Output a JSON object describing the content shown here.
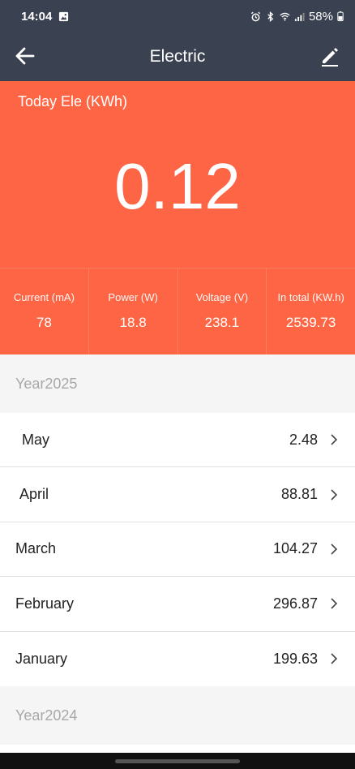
{
  "status_bar": {
    "time": "14:04",
    "battery": "58%"
  },
  "app_bar": {
    "title": "Electric"
  },
  "today": {
    "label": "Today Ele (KWh)",
    "value": "0.12"
  },
  "stats": [
    {
      "label": "Current (mA)",
      "value": "78"
    },
    {
      "label": "Power (W)",
      "value": "18.8"
    },
    {
      "label": "Voltage (V)",
      "value": "238.1"
    },
    {
      "label": "In total (KW.h)",
      "value": "2539.73"
    }
  ],
  "years": [
    {
      "label": "Year2025",
      "months": [
        {
          "name": "May",
          "value": "2.48"
        },
        {
          "name": "April",
          "value": "88.81"
        },
        {
          "name": "March",
          "value": "104.27"
        },
        {
          "name": "February",
          "value": "296.87"
        },
        {
          "name": "January",
          "value": "199.63"
        }
      ]
    },
    {
      "label": "Year2024",
      "months": []
    }
  ],
  "colors": {
    "header_bg": "#3a4150",
    "accent": "#fe6544"
  }
}
